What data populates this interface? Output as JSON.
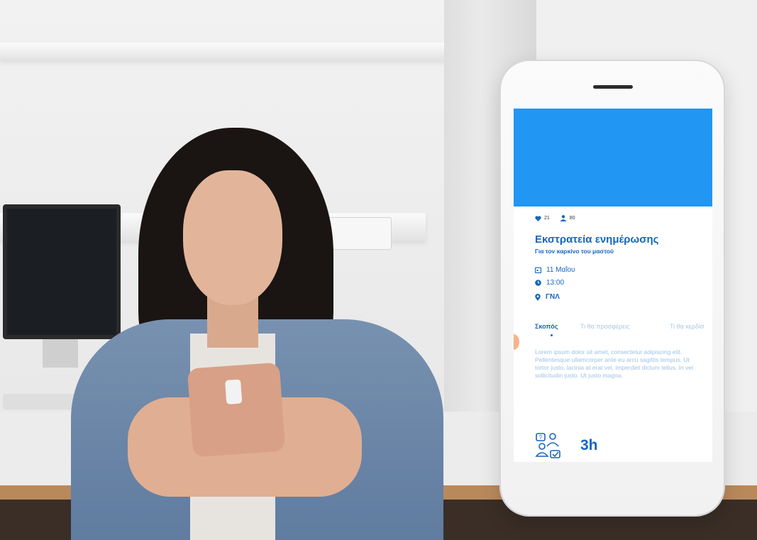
{
  "stats": {
    "likes": "21",
    "participants": "80"
  },
  "campaign": {
    "title": "Εκστρατεία ενημέρωσης",
    "subtitle": "Για τον καρκίνο του μαστού"
  },
  "details": {
    "date": "11 Μαΐου",
    "time": "13:00",
    "location": "ΓΝΛ"
  },
  "tabs": [
    {
      "label": "Σκοπός",
      "active": true
    },
    {
      "label": "Τι θα προσφέρεις",
      "active": false
    },
    {
      "label": "Τι θα κερδίσ",
      "active": false
    }
  ],
  "description": "Lorem ipsum dolor sit amet, consectetur adipiscing elit. Pellentesque ullamcorper ante eu arcu sagittis tempus. Ut tortor justo, lacinia at erat vel, imperdiet dictum tellus. In vel sollicitudin justo. Ut justo magna,",
  "footer": {
    "duration": "3h"
  },
  "colors": {
    "accent": "#1565c0",
    "banner": "#2196f3",
    "muted": "#9fc2e4"
  }
}
